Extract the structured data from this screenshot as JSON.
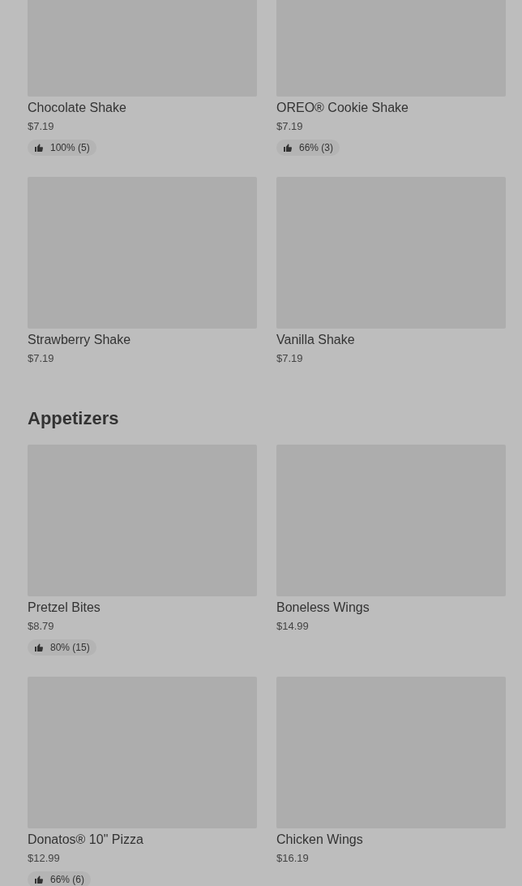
{
  "sections": [
    {
      "items": [
        {
          "name": "Chocolate Shake",
          "price": "$7.19",
          "rating": "100% (5)"
        },
        {
          "name": "OREO® Cookie Shake",
          "price": "$7.19",
          "rating": "66% (3)"
        },
        {
          "name": "Strawberry Shake",
          "price": "$7.19"
        },
        {
          "name": "Vanilla Shake",
          "price": "$7.19"
        }
      ]
    },
    {
      "title": "Appetizers",
      "items": [
        {
          "name": "Pretzel Bites",
          "price": "$8.79",
          "rating": "80% (15)"
        },
        {
          "name": "Boneless Wings",
          "price": "$14.99"
        },
        {
          "name": "Donatos® 10\" Pizza",
          "price": "$12.99",
          "rating": "66% (6)"
        },
        {
          "name": "Chicken Wings",
          "price": "$16.19"
        }
      ]
    }
  ]
}
